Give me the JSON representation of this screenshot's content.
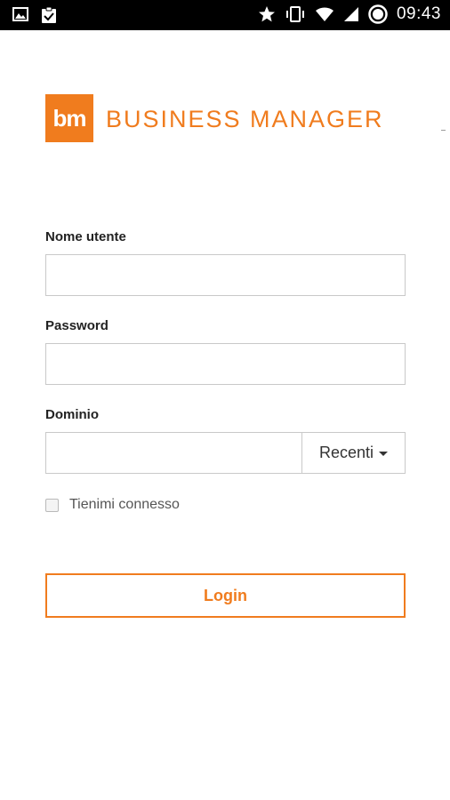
{
  "status_bar": {
    "time": "09:43",
    "left_icons": [
      "gallery-notification-icon",
      "clipboard-notification-icon"
    ],
    "right_icons": [
      "star-icon",
      "vibrate-icon",
      "wifi-icon",
      "signal-icon",
      "data-saver-icon"
    ]
  },
  "colors": {
    "brand_orange": "#f07c1e",
    "status_bar_bg": "#000000"
  },
  "logo": {
    "mark": "bm",
    "text": "BUSINESS MANAGER"
  },
  "form": {
    "username": {
      "label": "Nome utente",
      "value": ""
    },
    "password": {
      "label": "Password",
      "value": ""
    },
    "domain": {
      "label": "Dominio",
      "value": "",
      "recent_label": "Recenti"
    },
    "remember_me": {
      "label": "Tienimi connesso",
      "checked": false
    },
    "login_label": "Login"
  }
}
